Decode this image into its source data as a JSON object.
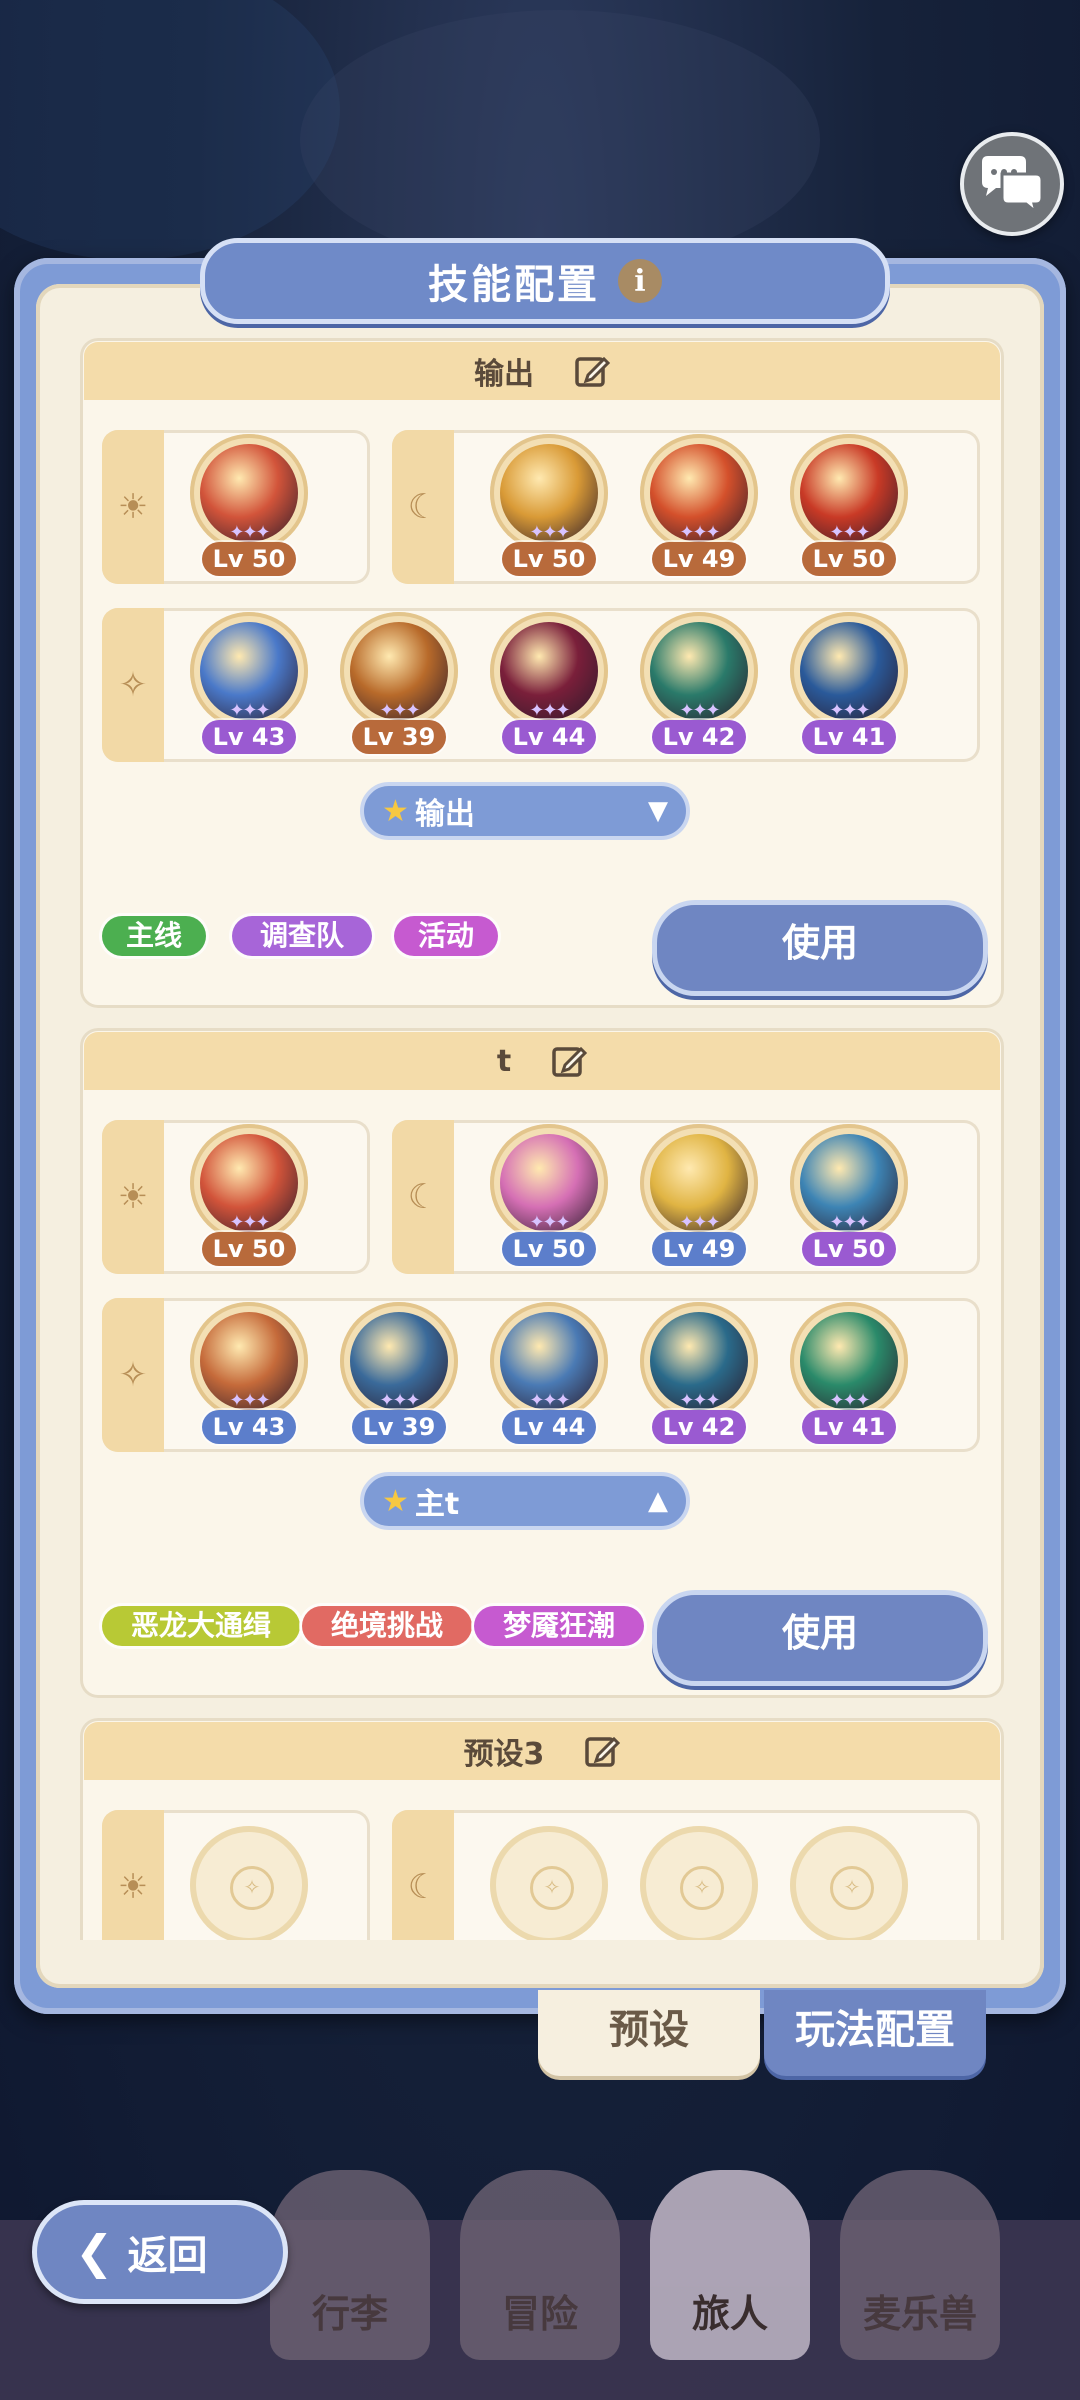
{
  "header": {
    "title": "技能配置",
    "info_glyph": "i"
  },
  "presets": [
    {
      "name": "输出",
      "sun_skills": [
        {
          "lv": "Lv 50",
          "color": "orange",
          "orb": "#d2543a"
        }
      ],
      "moon_skills": [
        {
          "lv": "Lv 50",
          "color": "orange",
          "orb": "#d99a36"
        },
        {
          "lv": "Lv 49",
          "color": "orange",
          "orb": "#d4502b"
        },
        {
          "lv": "Lv 50",
          "color": "orange",
          "orb": "#c93a26"
        }
      ],
      "star_skills": [
        {
          "lv": "Lv 43",
          "color": "purple",
          "orb": "#4a79c9"
        },
        {
          "lv": "Lv 39",
          "color": "orange",
          "orb": "#b86a2a"
        },
        {
          "lv": "Lv 44",
          "color": "purple",
          "orb": "#7a1f3a"
        },
        {
          "lv": "Lv 42",
          "color": "purple",
          "orb": "#2a7a6a"
        },
        {
          "lv": "Lv 41",
          "color": "purple",
          "orb": "#2a5a9a"
        }
      ],
      "dropdown": "输出",
      "dropdown_arrow": "▼",
      "tags": [
        {
          "label": "主线",
          "color": "#4caf50"
        },
        {
          "label": "调查队",
          "color": "#a765d8"
        },
        {
          "label": "活动",
          "color": "#c65ad0"
        }
      ],
      "use_label": "使用"
    },
    {
      "name": "t",
      "sun_skills": [
        {
          "lv": "Lv 50",
          "color": "orange",
          "orb": "#d2543a"
        }
      ],
      "moon_skills": [
        {
          "lv": "Lv 50",
          "color": "blue",
          "orb": "#d56fb4"
        },
        {
          "lv": "Lv 49",
          "color": "blue",
          "orb": "#e0b443"
        },
        {
          "lv": "Lv 50",
          "color": "purple",
          "orb": "#3d84b4"
        }
      ],
      "star_skills": [
        {
          "lv": "Lv 43",
          "color": "blue",
          "orb": "#c56a3a"
        },
        {
          "lv": "Lv 39",
          "color": "blue",
          "orb": "#3a6a9a"
        },
        {
          "lv": "Lv 44",
          "color": "blue",
          "orb": "#4a7ab4"
        },
        {
          "lv": "Lv 42",
          "color": "purple",
          "orb": "#2a6a8a"
        },
        {
          "lv": "Lv 41",
          "color": "purple",
          "orb": "#2a8a6a"
        }
      ],
      "dropdown": "主t",
      "dropdown_arrow": "▲",
      "tags": [
        {
          "label": "恶龙大通缉",
          "color": "#b8c935"
        },
        {
          "label": "绝境挑战",
          "color": "#e16a63"
        },
        {
          "label": "梦魇狂潮",
          "color": "#c65ad0"
        }
      ],
      "use_label": "使用"
    },
    {
      "name": "预设3"
    }
  ],
  "slot_icons": {
    "sun": "☀",
    "moon": "☾",
    "star": "✧"
  },
  "bottom_tabs": {
    "preset": "预设",
    "play": "玩法配置"
  },
  "nav": {
    "back": "返回",
    "items": [
      "行李",
      "冒险",
      "旅人",
      "麦乐兽"
    ],
    "active": "旅人"
  }
}
